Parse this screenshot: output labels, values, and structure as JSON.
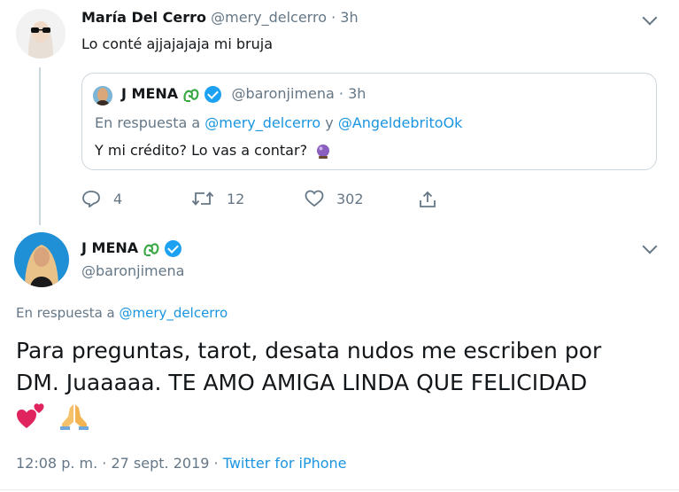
{
  "tweet1": {
    "display_name": "María Del Cerro",
    "handle": "@mery_delcerro",
    "time": "3h",
    "text": "Lo conté ajjajajaja mi bruja"
  },
  "quoted": {
    "display_name": "J MENA",
    "handle": "@baronjimena",
    "time": "3h",
    "reply_prefix": "En respuesta a",
    "reply_user1": "@mery_delcerro",
    "reply_joiner": "y",
    "reply_user2": "@AngeldebritoOk",
    "text": "Y mi crédito? Lo vas a contar?"
  },
  "actions": {
    "replies": "4",
    "retweets": "12",
    "likes": "302"
  },
  "main_tweet": {
    "display_name": "J MENA",
    "handle": "@baronjimena",
    "reply_prefix": "En respuesta a",
    "reply_user": "@mery_delcerro",
    "text_line1": "Para preguntas, tarot, desata nudos me escriben por",
    "text_line2": "DM. Juaaaaa. TE AMO AMIGA LINDA QUE FELICIDAD",
    "time": "12:08 p. m.",
    "separator": "·",
    "date": "27 sept. 2019",
    "source": "Twitter for iPhone"
  },
  "colors": {
    "link": "#1b95e0",
    "muted": "#657786",
    "verified": "#1da1f2"
  },
  "icons": [
    "chevron-down-icon",
    "reply-icon",
    "retweet-icon",
    "heart-icon",
    "share-icon",
    "verified-icon",
    "crystal-ball-emoji",
    "hearts-emoji",
    "praying-hands-emoji"
  ]
}
